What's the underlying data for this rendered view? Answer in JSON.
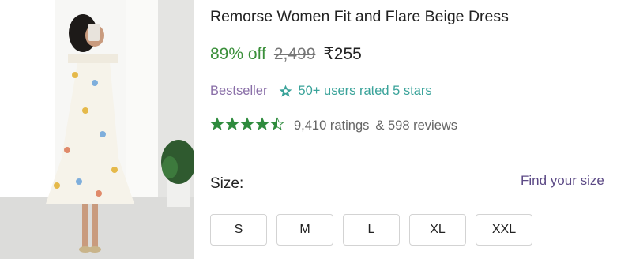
{
  "product": {
    "title": "Remorse Women Fit and Flare Beige Dress",
    "discount": "89% off",
    "mrp": "2,499",
    "price": "₹255",
    "bestseller": "Bestseller",
    "rated_text": "50+ users rated 5 stars",
    "rating_value": 4.5,
    "ratings_count": "9,410 ratings",
    "reviews": "& 598 reviews"
  },
  "size_section": {
    "label": "Size:",
    "find_link": "Find your size",
    "options": [
      "S",
      "M",
      "L",
      "XL",
      "XXL"
    ]
  },
  "colors": {
    "discount": "#3a8f3a",
    "bestseller": "#8a6fa8",
    "rated": "#3aa39a",
    "star": "#2e8b3d",
    "link": "#5c4a86"
  },
  "icons": {
    "badge": "star-badge-icon",
    "rating": "star-icon"
  }
}
